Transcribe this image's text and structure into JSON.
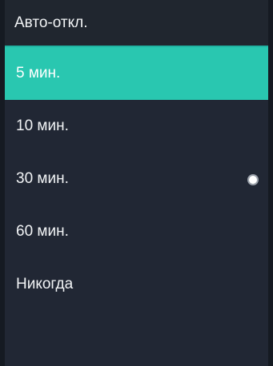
{
  "header": {
    "title": "Авто-откл."
  },
  "options": [
    {
      "label": "5 мин.",
      "selected": true
    },
    {
      "label": "10 мин.",
      "selected": false
    },
    {
      "label": "30 мин.",
      "selected": false
    },
    {
      "label": "60 мин.",
      "selected": false
    },
    {
      "label": "Никогда",
      "selected": false
    }
  ],
  "colors": {
    "accent": "#29c7b0",
    "background": "#212734",
    "text": "#f2f4f6"
  }
}
